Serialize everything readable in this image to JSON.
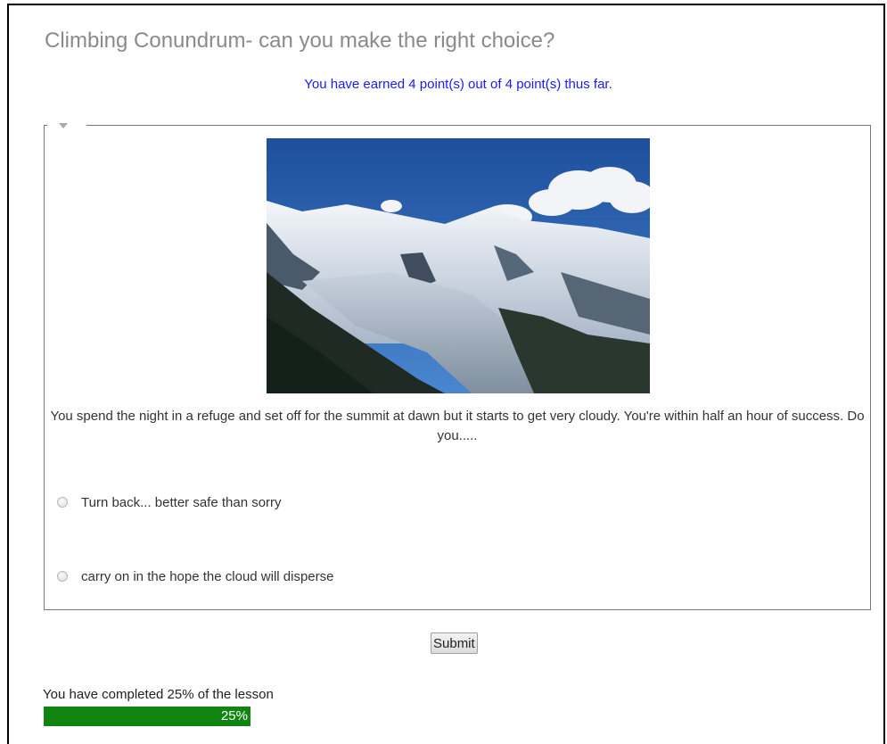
{
  "lesson": {
    "title": "Climbing Conundrum- can you make the right choice?",
    "points_message": "You have earned 4 point(s) out of 4 point(s) thus far."
  },
  "question": {
    "image_icon": "mountain-photo",
    "text": "You spend the night in a refuge and set off for the summit at dawn but it starts to get very cloudy. You're within half an hour of success. Do you.....",
    "options": [
      {
        "label": "Turn back... better safe than sorry",
        "selected": false
      },
      {
        "label": "carry on in the hope the cloud will disperse",
        "selected": false
      }
    ]
  },
  "actions": {
    "submit_label": "Submit"
  },
  "progress": {
    "label": "You have completed 25% of the lesson",
    "percent": 25,
    "percent_text": "25%",
    "fill_color": "#128412"
  }
}
